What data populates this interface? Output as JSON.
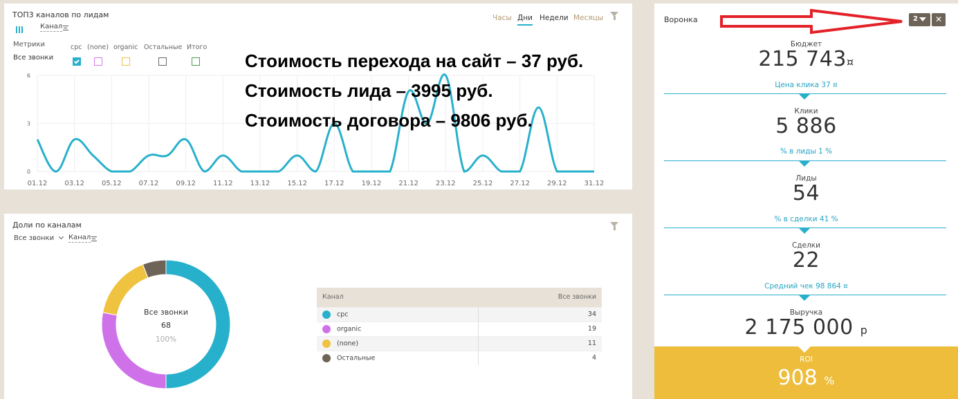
{
  "top_panel": {
    "title": "ТОП3 каналов по лидам",
    "channel_link": "Канал",
    "tabs": [
      {
        "label": "Часы",
        "active": false
      },
      {
        "label": "Дни",
        "active": true
      },
      {
        "label": "Недели",
        "active": false
      },
      {
        "label": "Месяцы",
        "active": false
      }
    ],
    "metrics_label": "Метрики",
    "metric_row": "Все звонки",
    "legend": [
      {
        "name": "cpc",
        "color": "#27b0cb",
        "checked": true
      },
      {
        "name": "(none)",
        "color": "#d37ae6",
        "checked": false
      },
      {
        "name": "organic",
        "color": "#efc240",
        "checked": false
      },
      {
        "name": "Остальные",
        "color": "#666666",
        "checked": false
      },
      {
        "name": "Итого",
        "color": "#4d9a4d",
        "checked": false
      }
    ]
  },
  "overlay_text": {
    "line1": "Стоимость перехода на сайт – 37 руб.",
    "line2": "Стоимость лида – 3995 руб.",
    "line3": "Стоимость договора – 9806 руб."
  },
  "chart_data": {
    "type": "line",
    "title": "ТОП3 каналов по лидам",
    "xlabel": "",
    "ylabel": "",
    "ylim": [
      0,
      6
    ],
    "yticks": [
      "0",
      "3",
      "6"
    ],
    "xticks": [
      "01.12",
      "03.12",
      "05.12",
      "07.12",
      "09.12",
      "11.12",
      "13.12",
      "15.12",
      "17.12",
      "19.12",
      "21.12",
      "23.12",
      "25.12",
      "27.12",
      "29.12",
      "31.12"
    ],
    "x": [
      "01.12",
      "02.12",
      "03.12",
      "04.12",
      "05.12",
      "06.12",
      "07.12",
      "08.12",
      "09.12",
      "10.12",
      "11.12",
      "12.12",
      "13.12",
      "14.12",
      "15.12",
      "16.12",
      "17.12",
      "18.12",
      "19.12",
      "20.12",
      "21.12",
      "22.12",
      "23.12",
      "24.12",
      "25.12",
      "26.12",
      "27.12",
      "28.12",
      "29.12",
      "30.12",
      "31.12"
    ],
    "series": [
      {
        "name": "cpc",
        "color": "#27b0cb",
        "values": [
          2,
          0,
          2,
          1,
          0,
          0,
          1,
          1,
          2,
          0,
          1,
          0,
          0,
          0,
          1,
          0,
          3,
          0,
          0,
          0,
          5,
          3,
          6,
          0,
          1,
          0,
          0,
          4,
          0,
          0,
          0
        ]
      }
    ],
    "grid": true
  },
  "share_panel": {
    "title": "Доли по каналам",
    "filter": "Все звонки",
    "channel_link": "Канал",
    "donut_label": "Все звонки",
    "donut_total": "68",
    "donut_percent": "100%",
    "table_header_channel": "Канал",
    "table_header_calls": "Все звонки",
    "rows": [
      {
        "name": "cpc",
        "value": 34,
        "color": "#27b0cb"
      },
      {
        "name": "organic",
        "value": 19,
        "color": "#cf72ea"
      },
      {
        "name": "(none)",
        "value": 11,
        "color": "#efc240"
      },
      {
        "name": "Остальные",
        "value": 4,
        "color": "#6e6357"
      }
    ]
  },
  "funnel": {
    "title": "Воронка",
    "badge": "2",
    "stages": [
      {
        "label": "Бюджет",
        "value": "215 743",
        "unit": "¤"
      },
      {
        "label": "Клики",
        "value": "5 886",
        "unit": ""
      },
      {
        "label": "Лиды",
        "value": "54",
        "unit": ""
      },
      {
        "label": "Сделки",
        "value": "22",
        "unit": ""
      },
      {
        "label": "Выручка",
        "value": "2 175 000",
        "unit": "р"
      }
    ],
    "links": [
      "Цена клика 37 ¤",
      "% в лиды 1 %",
      "% в сделки 41 %",
      "Средний чек 98 864 ¤"
    ],
    "roi_label": "ROI",
    "roi_value": "908",
    "roi_unit": "%"
  },
  "colors": {
    "accent": "#27b0cb",
    "roi_bg": "#edbd3b",
    "arrow": "#e32128"
  }
}
